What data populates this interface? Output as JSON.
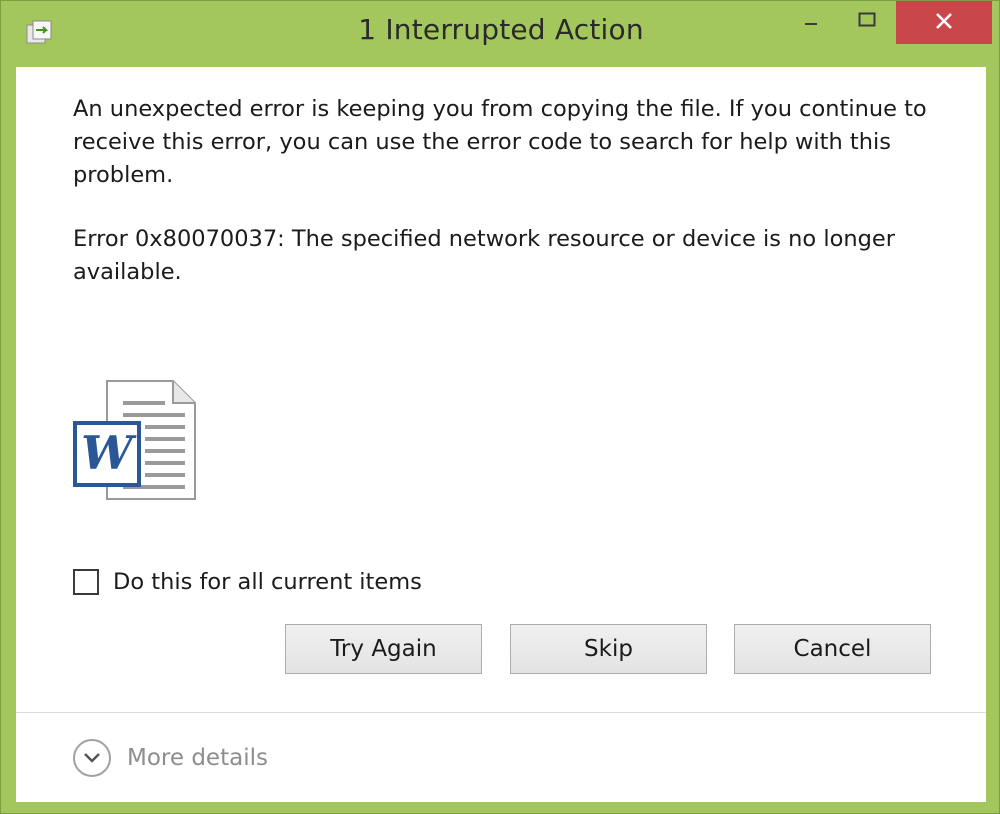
{
  "window": {
    "title": "1 Interrupted Action"
  },
  "caption_buttons": {
    "minimize_icon": "minimize-icon",
    "maximize_icon": "maximize-icon",
    "close_icon": "close-icon"
  },
  "dialog": {
    "message": "An unexpected error is keeping you from copying the file. If you continue to receive this error, you can use the error code to search for help with this problem.",
    "error": "Error 0x80070037: The specified network resource or device is no longer available.",
    "file_icon": "word-document-icon",
    "checkbox_label": "Do this for all current items",
    "checkbox_checked": false,
    "buttons": {
      "try_again": "Try Again",
      "skip": "Skip",
      "cancel": "Cancel"
    },
    "more_details": "More details"
  },
  "colors": {
    "frame": "#a4c75d",
    "close_button": "#c9464a",
    "word_blue": "#2b5797"
  }
}
